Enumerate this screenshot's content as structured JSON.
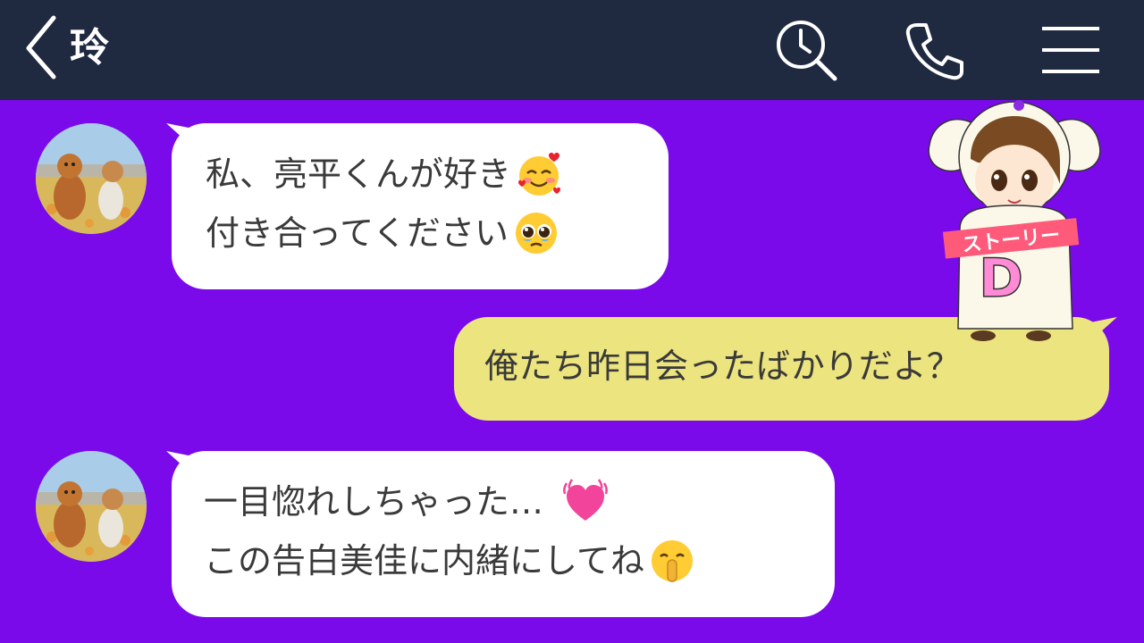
{
  "header": {
    "title": "玲",
    "icons": [
      "back-chevron-icon",
      "search-history-icon",
      "phone-icon",
      "hamburger-menu-icon"
    ]
  },
  "messages": [
    {
      "sender": "other",
      "lines": [
        "私、亮平くんが好き",
        "付き合ってください"
      ],
      "emojis": [
        "smiling-face-with-hearts",
        "pleading-face"
      ]
    },
    {
      "sender": "me",
      "lines": [
        "俺たち昨日会ったばかりだよ？"
      ]
    },
    {
      "sender": "other",
      "lines": [
        "一目惚れしちゃった…",
        "この告白美佳に内緒にしてね"
      ],
      "emojis": [
        "beating-heart",
        "shushing-face"
      ]
    }
  ],
  "sticker": {
    "label": "ストーリー",
    "letter": "D"
  },
  "colors": {
    "header_bg": "#1f2940",
    "chat_bg": "#7a0aea",
    "incoming_bubble": "#ffffff",
    "outgoing_bubble": "#ece47e",
    "text": "#3a3a3a"
  }
}
